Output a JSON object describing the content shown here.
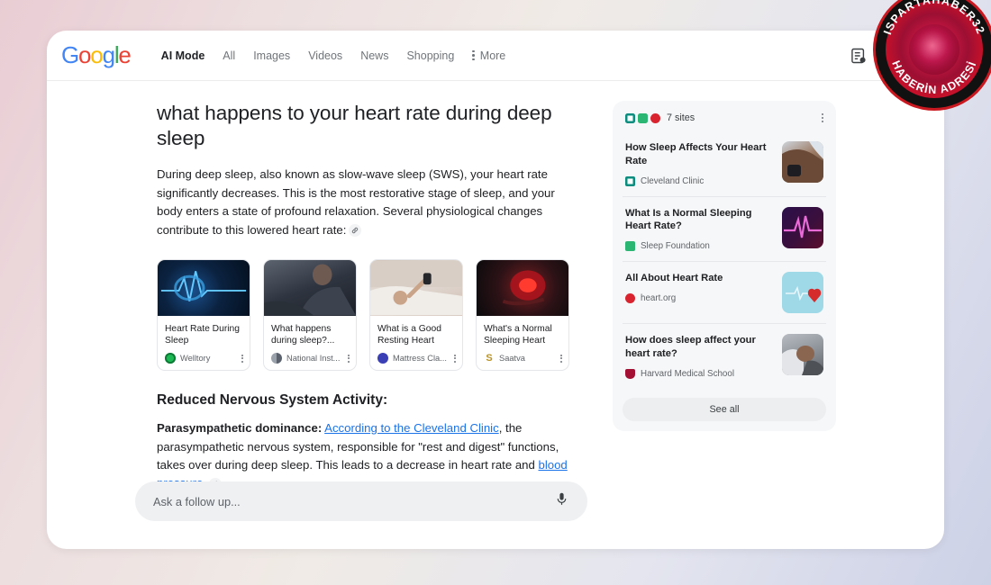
{
  "header": {
    "logo_letters": [
      "G",
      "o",
      "o",
      "g",
      "l",
      "e"
    ],
    "tabs": [
      {
        "label": "AI Mode",
        "active": true
      },
      {
        "label": "All",
        "active": false
      },
      {
        "label": "Images",
        "active": false
      },
      {
        "label": "Videos",
        "active": false
      },
      {
        "label": "News",
        "active": false
      },
      {
        "label": "Shopping",
        "active": false
      }
    ],
    "more_label": "More",
    "icons": [
      "notes-icon",
      "lab-flask-icon",
      "overflow-menu-icon"
    ]
  },
  "main": {
    "question": "what happens to your heart rate during deep sleep",
    "intro": "During deep sleep, also known as slow-wave sleep (SWS), your heart rate significantly decreases. This is the most restorative stage of sleep, and your body enters a state of profound relaxation. Several physiological changes contribute to this lowered heart rate:",
    "section_heading": "Reduced Nervous System Activity:",
    "section_lead": "Parasympathetic dominance:",
    "section_link1": "According to the Cleveland Clinic",
    "section_body1": ", the parasympathetic nervous system, responsible for \"rest and digest\" functions, takes over during deep sleep. This leads to a decrease in heart rate and ",
    "section_link2": "blood pressure",
    "section_body2": "."
  },
  "cards": [
    {
      "title": "Heart Rate During Sleep",
      "source": "Welltory",
      "favicon_color": "#1db954",
      "thumb": "img-ecg"
    },
    {
      "title": "What happens during sleep?...",
      "source": "National Inst...",
      "favicon_color": "#6b7280",
      "thumb": "img-sleep"
    },
    {
      "title": "What is a Good Resting Heart Rat...",
      "source": "Mattress Cla...",
      "favicon_color": "#3b3fb5",
      "thumb": "img-bed"
    },
    {
      "title": "What's a Normal Sleeping Heart R...",
      "source": "Saatva",
      "favicon_color": "#c9a227",
      "thumb": "img-heart"
    }
  ],
  "sources_panel": {
    "count_label": "7 sites",
    "head_favicons": [
      "#0a8c7e",
      "#2bb673",
      "#d9232e"
    ],
    "items": [
      {
        "title": "How Sleep Affects Your Heart Rate",
        "source": "Cleveland Clinic",
        "favicon_color": "#0a8c7e",
        "thumb_style": "wrist"
      },
      {
        "title": "What Is a Normal Sleeping Heart Rate?",
        "source": "Sleep Foundation",
        "favicon_color": "#2bb673",
        "thumb_style": "ecg"
      },
      {
        "title": "All About Heart Rate",
        "source": "heart.org",
        "favicon_color": "#d9232e",
        "thumb_style": "heartblue"
      },
      {
        "title": "How does sleep affect your heart rate?",
        "source": "Harvard Medical School",
        "favicon_color": "#a41034",
        "thumb_style": "pillow"
      }
    ],
    "see_all_label": "See all"
  },
  "followup": {
    "placeholder": "Ask a follow up...",
    "mic_icon": "microphone-icon"
  },
  "watermark": {
    "top_text": "ISPARTAHABER32",
    "bottom_text": "HABERİN ADRESİ"
  }
}
